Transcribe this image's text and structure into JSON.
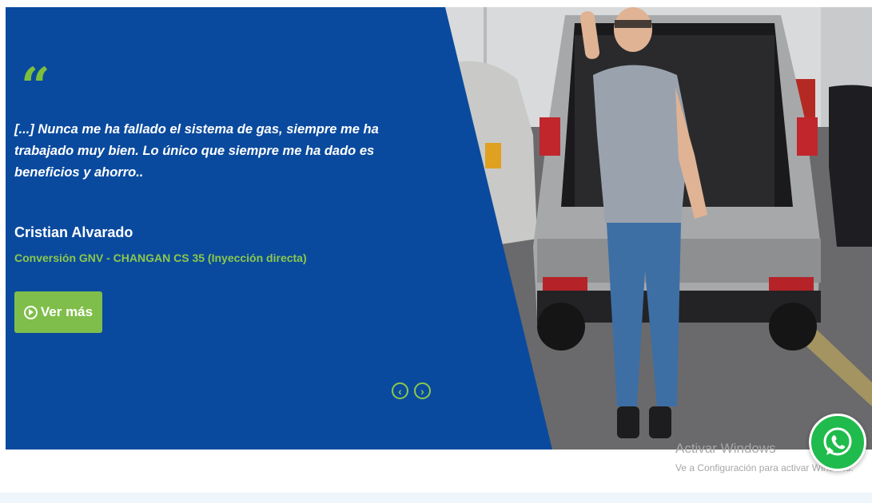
{
  "testimonial": {
    "quote_mark": "“",
    "quote": "[...] Nunca me ha fallado el sistema de gas, siempre me ha trabajado muy bien. Lo único que siempre me ha dado es beneficios y ahorro..",
    "author": "Cristian Alvarado",
    "vehicle": "Conversión GNV - CHANGAN CS 35 (Inyección directa)",
    "cta_label": "Ver más"
  },
  "carousel": {
    "prev_label": "‹",
    "next_label": "›"
  },
  "system_overlay": {
    "title": "Activar Windows",
    "subtitle": "Ve a Configuración para activar Windows."
  },
  "whatsapp": {
    "icon": "whatsapp-icon"
  },
  "colors": {
    "panel_blue": "#0a4a9e",
    "accent_green": "#7fbe4a",
    "whatsapp_green": "#1fbb4c"
  }
}
